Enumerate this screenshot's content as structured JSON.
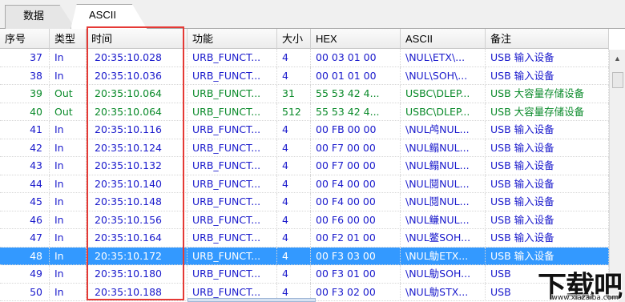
{
  "tabs": [
    {
      "label": "数据"
    },
    {
      "label": "ASCII"
    }
  ],
  "columns": {
    "idx": "序号",
    "type": "类型",
    "time": "时间",
    "func": "功能",
    "size": "大小",
    "hex": "HEX",
    "ascii": "ASCII",
    "note": "备注"
  },
  "rows": [
    {
      "idx": "37",
      "type": "In",
      "time": "20:35:10.028",
      "func": "URB_FUNCT...",
      "size": "4",
      "hex": "00 03 01 00",
      "ascii": "\\NUL\\ETX\\...",
      "note": "USB 输入设备",
      "color": "blue"
    },
    {
      "idx": "38",
      "type": "In",
      "time": "20:35:10.036",
      "func": "URB_FUNCT...",
      "size": "4",
      "hex": "00 01 01 00",
      "ascii": "\\NUL\\SOH\\...",
      "note": "USB 输入设备",
      "color": "blue"
    },
    {
      "idx": "39",
      "type": "Out",
      "time": "20:35:10.064",
      "func": "URB_FUNCT...",
      "size": "31",
      "hex": "55 53 42 4...",
      "ascii": "USBC\\DLEP...",
      "note": "USB 大容量存储设备",
      "color": "green"
    },
    {
      "idx": "40",
      "type": "Out",
      "time": "20:35:10.064",
      "func": "URB_FUNCT...",
      "size": "512",
      "hex": "55 53 42 4...",
      "ascii": "USBC\\DLEP...",
      "note": "USB 大容量存储设备",
      "color": "green"
    },
    {
      "idx": "41",
      "type": "In",
      "time": "20:35:10.116",
      "func": "URB_FUNCT...",
      "size": "4",
      "hex": "00 FB 00 00",
      "ascii": "\\NUL鸬NUL...",
      "note": "USB 输入设备",
      "color": "blue"
    },
    {
      "idx": "42",
      "type": "In",
      "time": "20:35:10.124",
      "func": "URB_FUNCT...",
      "size": "4",
      "hex": "00 F7 00 00",
      "ascii": "\\NUL鳎NUL...",
      "note": "USB 输入设备",
      "color": "blue"
    },
    {
      "idx": "43",
      "type": "In",
      "time": "20:35:10.132",
      "func": "URB_FUNCT...",
      "size": "4",
      "hex": "00 F7 00 00",
      "ascii": "\\NUL鳎NUL...",
      "note": "USB 输入设备",
      "color": "blue"
    },
    {
      "idx": "44",
      "type": "In",
      "time": "20:35:10.140",
      "func": "URB_FUNCT...",
      "size": "4",
      "hex": "00 F4 00 00",
      "ascii": "\\NUL鬩NUL...",
      "note": "USB 输入设备",
      "color": "blue"
    },
    {
      "idx": "45",
      "type": "In",
      "time": "20:35:10.148",
      "func": "URB_FUNCT...",
      "size": "4",
      "hex": "00 F4 00 00",
      "ascii": "\\NUL鬩NUL...",
      "note": "USB 输入设备",
      "color": "blue"
    },
    {
      "idx": "46",
      "type": "In",
      "time": "20:35:10.156",
      "func": "URB_FUNCT...",
      "size": "4",
      "hex": "00 F6 00 00",
      "ascii": "\\NUL鳒NUL...",
      "note": "USB 输入设备",
      "color": "blue"
    },
    {
      "idx": "47",
      "type": "In",
      "time": "20:35:10.164",
      "func": "URB_FUNCT...",
      "size": "4",
      "hex": "00 F2 01 00",
      "ascii": "\\NUL鳖SOH...",
      "note": "USB 输入设备",
      "color": "blue"
    },
    {
      "idx": "48",
      "type": "In",
      "time": "20:35:10.172",
      "func": "URB_FUNCT...",
      "size": "4",
      "hex": "00 F3 03 00",
      "ascii": "\\NUL鳨ETX...",
      "note": "USB 输入设备",
      "color": "selected"
    },
    {
      "idx": "49",
      "type": "In",
      "time": "20:35:10.180",
      "func": "URB_FUNCT...",
      "size": "4",
      "hex": "00 F3 01 00",
      "ascii": "\\NUL鳨SOH...",
      "note": "USB",
      "color": "blue"
    },
    {
      "idx": "50",
      "type": "In",
      "time": "20:35:10.188",
      "func": "URB_FUNCT...",
      "size": "4",
      "hex": "00 F3 02 00",
      "ascii": "\\NUL鳨STX...",
      "note": "USB",
      "color": "blue"
    }
  ],
  "watermark": {
    "logo": "下载吧",
    "url": "www.xiazaiba.com"
  },
  "colors": {
    "highlight": "#e53935",
    "selected": "#3399ff",
    "in_text": "#1a1acc",
    "out_text": "#0a8a2a"
  }
}
